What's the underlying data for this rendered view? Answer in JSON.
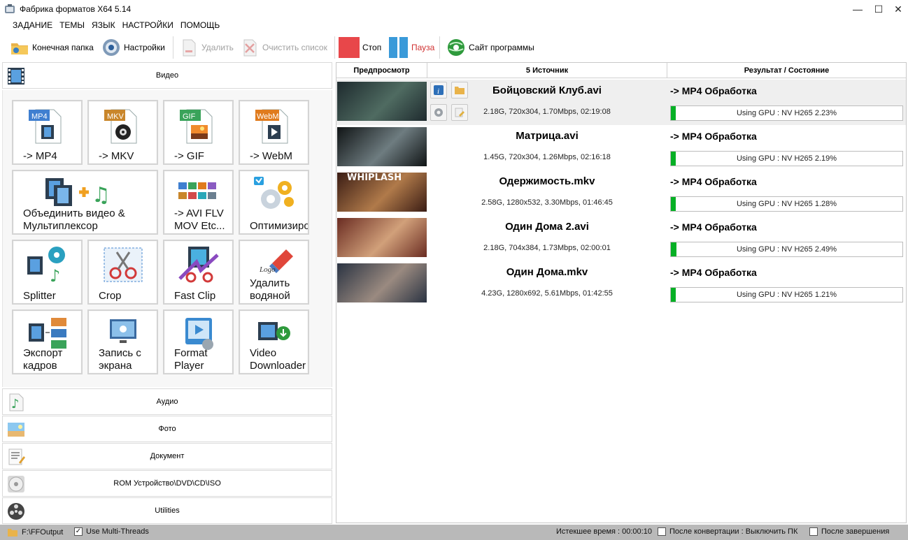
{
  "window": {
    "title": "Фабрика форматов X64 5.14",
    "minimize": "—",
    "maximize": "☐",
    "close": "✕"
  },
  "menu": [
    "ЗАДАНИЕ",
    "ТЕМЫ",
    "ЯЗЫК",
    "НАСТРОЙКИ",
    "ПОМОЩЬ"
  ],
  "toolbar": {
    "output_folder": "Конечная папка",
    "settings": "Настройки",
    "remove": "Удалить",
    "clear_list": "Очистить список",
    "stop": "Стоп",
    "pause": "Пауза",
    "website": "Сайт программы"
  },
  "categories": {
    "video": "Видео",
    "audio": "Аудио",
    "photo": "Фото",
    "document": "Документ",
    "rom": "ROM Устройство\\DVD\\CD\\ISO",
    "utilities": "Utilities"
  },
  "tiles": [
    {
      "label": "-> MP4",
      "badge": "MP4",
      "badge_color": "#3f7fd0"
    },
    {
      "label": "-> MKV",
      "badge": "MKV",
      "badge_color": "#c9862b"
    },
    {
      "label": "-> GIF",
      "badge": "GIF",
      "badge_color": "#3aa35a"
    },
    {
      "label": "-> WebM",
      "badge": "WebM",
      "badge_color": "#e07b1d"
    },
    {
      "label": "Объединить видео &\nМультиплексор"
    },
    {
      "label": "-> AVI FLV\nMOV Etc..."
    },
    {
      "label": "Оптимизиро"
    },
    {
      "label": "Splitter"
    },
    {
      "label": "Crop"
    },
    {
      "label": "Fast Clip"
    },
    {
      "label": "Удалить\nводяной",
      "logo_text": "Logo"
    },
    {
      "label": "Экспорт\nкадров"
    },
    {
      "label": "Запись с\nэкрана"
    },
    {
      "label": "Format\nPlayer"
    },
    {
      "label": "Video\nDownloader"
    }
  ],
  "queue": {
    "col_preview": "Предпросмотр",
    "col_source": "5 Источник",
    "col_result": "Результат / Состояние",
    "rows": [
      {
        "name": "Бойцовский Клуб.avi",
        "info": "2.18G, 720x304, 1.70Mbps, 02:19:08",
        "target": "-> MP4 Обработка",
        "status": "Using GPU : NV H265 2.23%",
        "progress": 0.0223,
        "selected": true,
        "thumb_bg": "#1e2a2e",
        "thumb_accent": "#4f6b61"
      },
      {
        "name": "Матрица.avi",
        "info": "1.45G, 720x304, 1.26Mbps, 02:16:18",
        "target": "-> MP4 Обработка",
        "status": "Using GPU : NV H265 2.19%",
        "progress": 0.0219,
        "selected": false,
        "thumb_bg": "#101415",
        "thumb_accent": "#6e7c80"
      },
      {
        "name": "Одержимость.mkv",
        "info": "2.58G, 1280x532, 3.30Mbps, 01:46:45",
        "target": "-> MP4 Обработка",
        "status": "Using GPU : NV H265 1.28%",
        "progress": 0.0128,
        "selected": false,
        "thumb_bg": "#3a1c14",
        "thumb_accent": "#b07a4a",
        "thumb_text": "WHIPLASH"
      },
      {
        "name": "Один Дома 2.avi",
        "info": "2.18G, 704x384, 1.73Mbps, 02:00:01",
        "target": "-> MP4 Обработка",
        "status": "Using GPU : NV H265 2.49%",
        "progress": 0.0249,
        "selected": false,
        "thumb_bg": "#6a2c22",
        "thumb_accent": "#d1a07a"
      },
      {
        "name": "Один Дома.mkv",
        "info": "4.23G, 1280x692, 5.61Mbps, 01:42:55",
        "target": "-> MP4 Обработка",
        "status": "Using GPU : NV H265 1.21%",
        "progress": 0.0121,
        "selected": false,
        "thumb_bg": "#2a3342",
        "thumb_accent": "#9a8a80"
      }
    ]
  },
  "status": {
    "output_path": "F:\\FFOutput",
    "multithreads": "Use Multi-Threads",
    "multithreads_checked": true,
    "elapsed": "Истекшее время : 00:00:10",
    "after_convert": "После конвертации : Выключить ПК",
    "after_finish": "После завершения"
  },
  "colors": {
    "stop": "#e8474a",
    "pause": "#3a9ad9",
    "pause_text": "#d03030",
    "progress_fill": "#06b025",
    "statusbar_bg": "#b9b9b9"
  }
}
